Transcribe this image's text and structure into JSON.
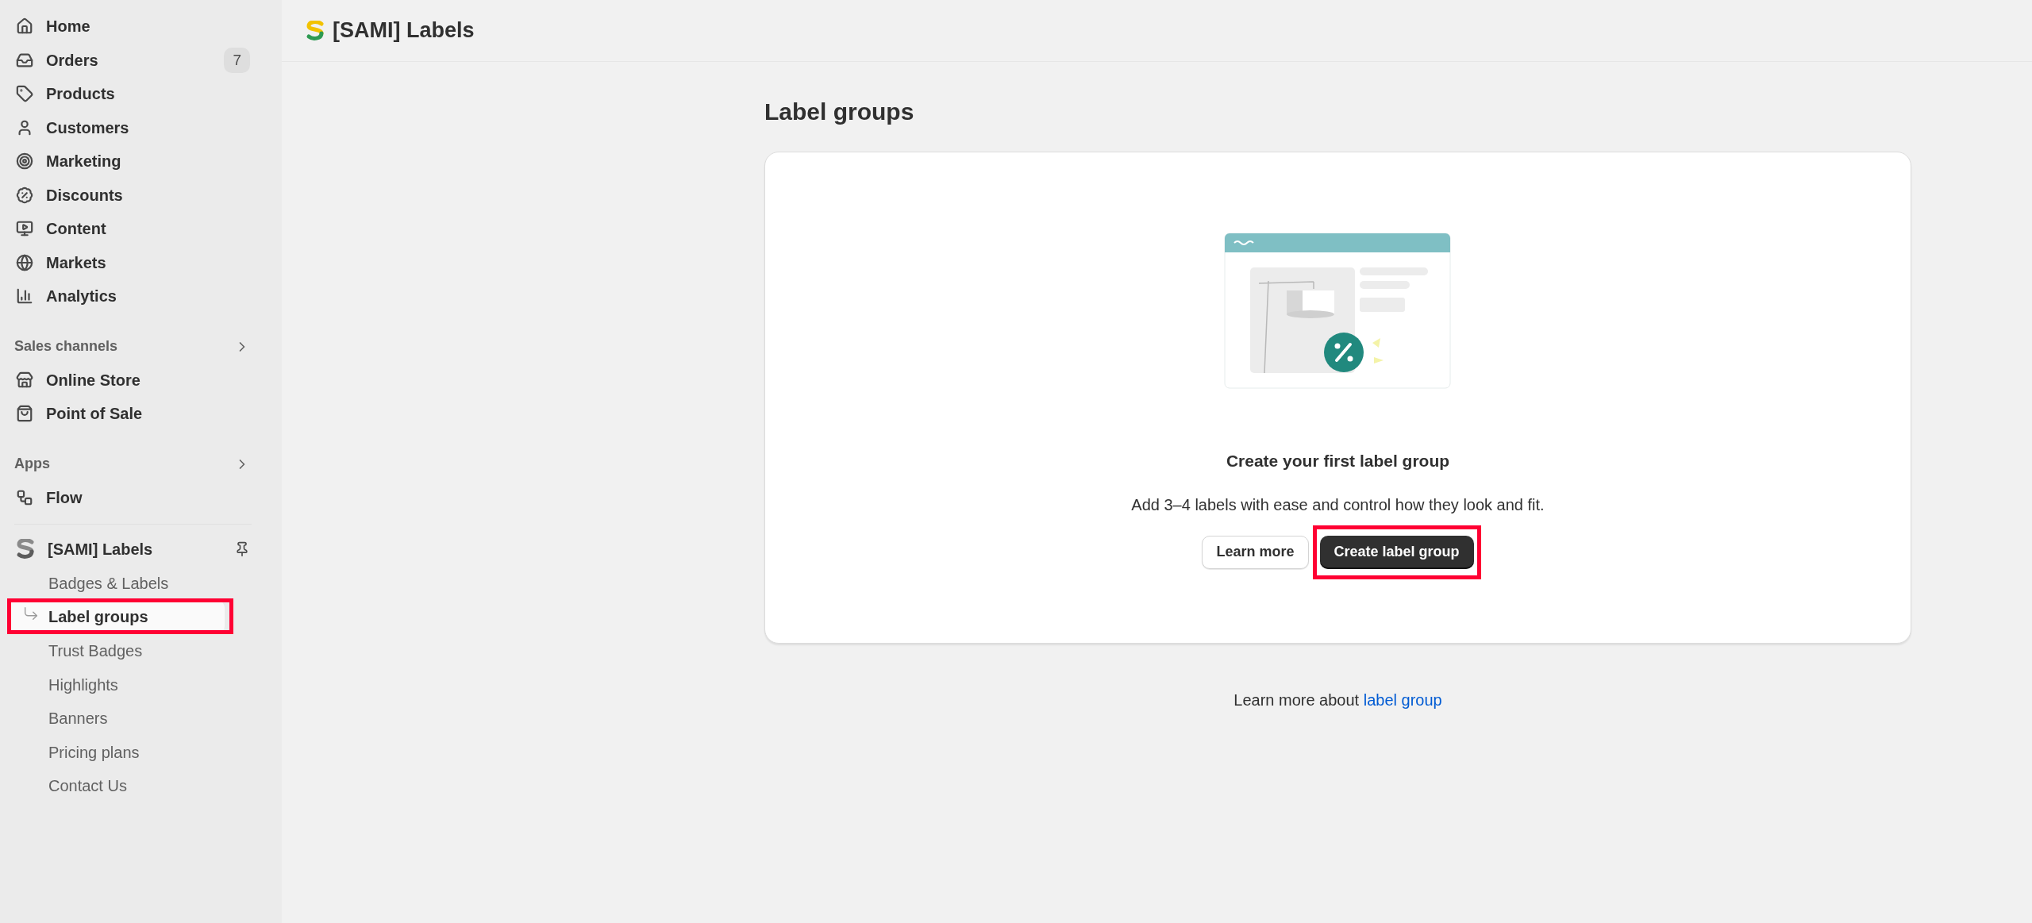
{
  "sidebar": {
    "main_items": [
      {
        "label": "Home"
      },
      {
        "label": "Orders",
        "badge": "7"
      },
      {
        "label": "Products"
      },
      {
        "label": "Customers"
      },
      {
        "label": "Marketing"
      },
      {
        "label": "Discounts"
      },
      {
        "label": "Content"
      },
      {
        "label": "Markets"
      },
      {
        "label": "Analytics"
      }
    ],
    "sections": [
      {
        "title": "Sales channels",
        "items": [
          {
            "label": "Online Store"
          },
          {
            "label": "Point of Sale"
          }
        ]
      },
      {
        "title": "Apps",
        "items": [
          {
            "label": "Flow"
          }
        ]
      }
    ],
    "app": {
      "name": "[SAMI] Labels",
      "items": [
        {
          "label": "Badges & Labels",
          "selected": false
        },
        {
          "label": "Label groups",
          "selected": true,
          "highlighted": true
        },
        {
          "label": "Trust Badges",
          "selected": false
        },
        {
          "label": "Highlights",
          "selected": false
        },
        {
          "label": "Banners",
          "selected": false
        },
        {
          "label": "Pricing plans",
          "selected": false
        },
        {
          "label": "Contact Us",
          "selected": false
        }
      ]
    }
  },
  "header": {
    "title": "[SAMI] Labels"
  },
  "page": {
    "heading": "Label groups",
    "empty_state": {
      "title": "Create your first label group",
      "description": "Add 3–4 labels with ease and control how they look and fit.",
      "buttons": [
        {
          "label": "Learn more",
          "kind": "secondary"
        },
        {
          "label": "Create label group",
          "kind": "primary",
          "highlighted": true
        }
      ]
    },
    "footer": {
      "text": "Learn more about",
      "link": "label group"
    }
  }
}
